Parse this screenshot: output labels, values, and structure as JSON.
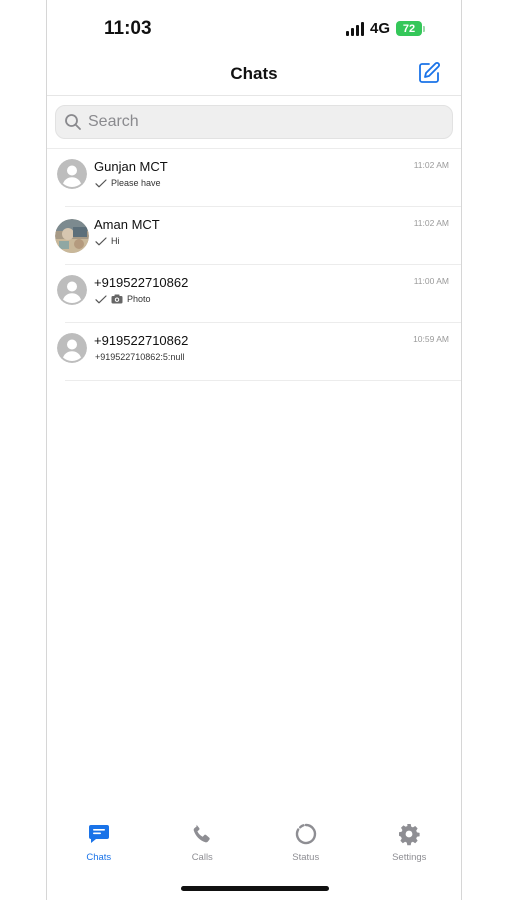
{
  "status_bar": {
    "time": "11:03",
    "network": "4G",
    "battery": "72"
  },
  "header": {
    "title": "Chats",
    "compose_icon": "compose-icon"
  },
  "search": {
    "placeholder": "Search"
  },
  "chats": [
    {
      "name": "Gunjan MCT",
      "preview": "Please have",
      "time": "11:02 AM",
      "avatar": "person-placeholder",
      "status": "sent-check"
    },
    {
      "name": "Aman MCT",
      "preview": "Hi",
      "time": "11:02 AM",
      "avatar": "photo",
      "status": "sent-check"
    },
    {
      "name": "+919522710862",
      "preview": "Photo",
      "time": "11:00 AM",
      "avatar": "person-placeholder",
      "status": "sent-check",
      "attachment": "camera-icon"
    },
    {
      "name": "+919522710862",
      "preview": "+919522710862:5:null",
      "time": "10:59 AM",
      "avatar": "person-placeholder"
    }
  ],
  "tabs": [
    {
      "label": "Chats",
      "icon": "chat-bubble-icon",
      "active": true
    },
    {
      "label": "Calls",
      "icon": "phone-icon"
    },
    {
      "label": "Status",
      "icon": "status-ring-icon"
    },
    {
      "label": "Settings",
      "icon": "gear-icon"
    }
  ],
  "colors": {
    "accent": "#1a73e8",
    "battery": "#34c759",
    "inactive": "#8e8e93"
  }
}
